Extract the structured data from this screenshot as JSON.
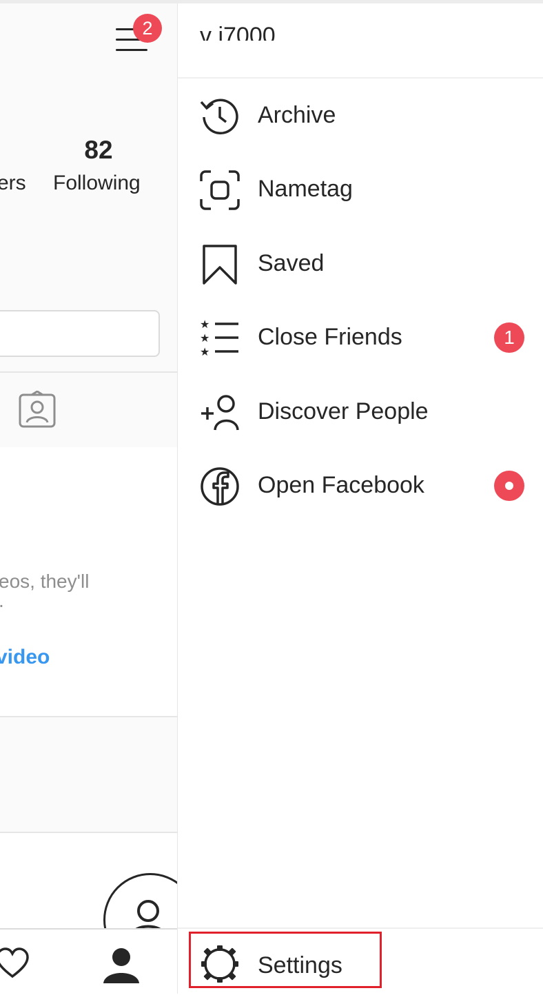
{
  "profile": {
    "notification_count": "2",
    "following_count": "82",
    "followers_label_partial": "ers",
    "following_label": "Following",
    "empty_text_line1": "eos, they'll",
    "empty_text_line2": ".",
    "share_link_partial": "video"
  },
  "drawer": {
    "username_partial": "v          i7000",
    "items": [
      {
        "label": "Archive",
        "icon": "archive-icon"
      },
      {
        "label": "Nametag",
        "icon": "nametag-icon"
      },
      {
        "label": "Saved",
        "icon": "bookmark-icon"
      },
      {
        "label": "Close Friends",
        "icon": "close-friends-icon",
        "badge": "1"
      },
      {
        "label": "Discover People",
        "icon": "add-person-icon"
      },
      {
        "label": "Open Facebook",
        "icon": "facebook-icon"
      }
    ],
    "settings_label": "Settings"
  },
  "colors": {
    "badge": "#ed4956",
    "link": "#3897f0",
    "highlight": "#e0202a",
    "text": "#262626"
  }
}
